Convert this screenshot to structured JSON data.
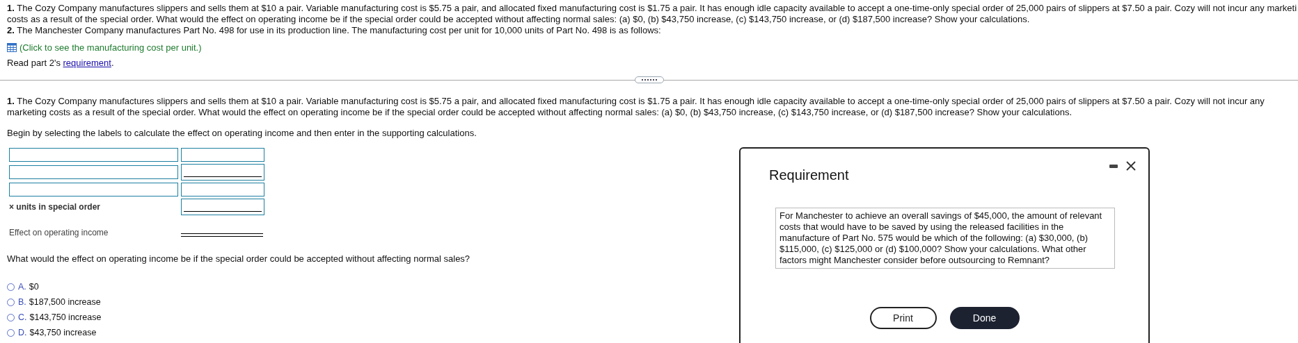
{
  "problem_lines": [
    "**1.** The Cozy Company manufactures slippers and sells them at $10 a pair. Variable manufacturing cost is $5.75 a pair, and allocated fixed manufacturing cost is $1.75 a pair. It has enough idle capacity available to accept a one-time-only special order of 25,000 pairs of slippers at $7.50 a pair. Cozy will not incur any marketi",
    "costs as a result of the special order. What would the effect on operating income be if the special order could be accepted without affecting normal sales: (a) $0, (b) $43,750 increase, (c) $143,750 increase, or (d) $187,500 increase? Show your calculations.",
    "**2.** The Manchester Company manufactures Part No. 498 for use in its production line. The manufacturing cost per unit for 10,000 units of Part No. 498 is as follows:"
  ],
  "data_link": "(Click to see the manufacturing cost per unit.)",
  "read_requirement": {
    "before": "Read part 2's ",
    "link": "requirement",
    "after": "."
  },
  "question": "**1.** The Cozy Company manufactures slippers and sells them at $10 a pair. Variable manufacturing cost is $5.75 a pair, and allocated fixed manufacturing cost is $1.75 a pair. It has enough idle capacity available to accept a one-time-only special order of 25,000 pairs of slippers at $7.50 a pair. Cozy will not incur any marketing costs as a result of the special order. What would the effect on operating income be if the special order could be accepted without affecting normal sales: (a) $0, (b) $43,750 increase, (c) $143,750 increase, or (d) $187,500 increase? Show your calculations.",
  "instruction": "Begin by selecting the labels to calculate the effect on operating income and then enter in the supporting calculations.",
  "calc_rows": [
    {
      "kind": "pair",
      "underline": false
    },
    {
      "kind": "pair",
      "underline": true
    },
    {
      "kind": "pair",
      "underline": false
    },
    {
      "kind": "labeled",
      "label": "× units in special order",
      "underline": true
    },
    {
      "kind": "total",
      "label": "Effect on operating income"
    }
  ],
  "mc_question": "What would the effect on operating income be if the special order could be accepted without affecting normal sales?",
  "options": [
    {
      "letter": "A.",
      "text": "$0",
      "selected": false
    },
    {
      "letter": "B.",
      "text": "$187,500 increase",
      "selected": false
    },
    {
      "letter": "C.",
      "text": "$143,750 increase",
      "selected": false
    },
    {
      "letter": "D.",
      "text": "$43,750 increase",
      "selected": false
    }
  ],
  "dialog": {
    "title": "Requirement",
    "text": "For Manchester to achieve an overall savings of $45,000, the amount of relevant costs that would have to be saved by using the released facilities in the manufacture of Part No. 575 would be which of the following: (a) $30,000, (b) $115,000, (c) $125,000 or (d) $100,000? Show your calculations. What other factors might Manchester consider before outsourcing to Remnant?",
    "buttons": [
      "Print",
      "Done"
    ]
  }
}
